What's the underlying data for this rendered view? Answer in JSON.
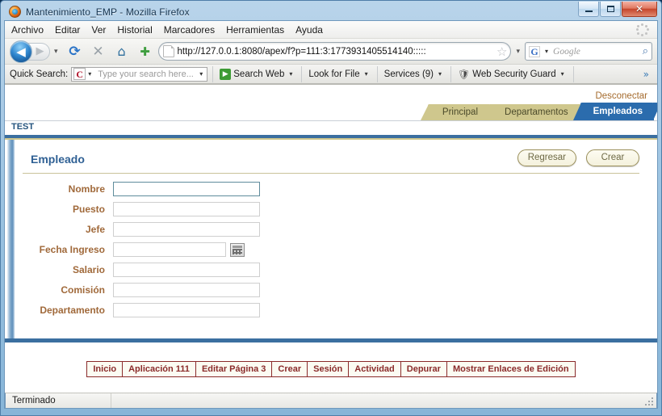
{
  "window": {
    "title": "Mantenimiento_EMP - Mozilla Firefox",
    "logo_icon": "firefox-icon",
    "controls": {
      "minimize": "minimize-icon",
      "maximize": "maximize-icon",
      "close": "✕"
    }
  },
  "menubar": {
    "items": [
      {
        "label": "Archivo"
      },
      {
        "label": "Editar"
      },
      {
        "label": "Ver"
      },
      {
        "label": "Historial"
      },
      {
        "label": "Marcadores"
      },
      {
        "label": "Herramientas"
      },
      {
        "label": "Ayuda"
      }
    ],
    "throbber_icon": "loading-spinner-icon"
  },
  "navbar": {
    "back_icon": "◀",
    "forward_icon": "▶",
    "history_dropdown_icon": "▾",
    "reload_icon": "⟳",
    "stop_icon": "✕",
    "home_icon": "⌂",
    "newpage_icon": "✚",
    "url": "http://127.0.0.1:8080/apex/f?p=111:3:1773931405514140:::::",
    "url_favicon": "page-icon",
    "bookmark_star_icon": "☆",
    "url_dropdown_icon": "▾",
    "search_engine_icon": "G",
    "search_engine_dropdown_icon": "▾",
    "search_placeholder": "Google",
    "search_magnifier_icon": "⌕"
  },
  "addonbar": {
    "quick_search_label": "Quick Search:",
    "quick_search_icon": "C",
    "quick_search_placeholder": "Type your search here...",
    "quick_search_dropdown_icon": "▾",
    "search_web_label": "Search Web",
    "search_web_icon": "▶",
    "search_web_dropdown_icon": "▾",
    "look_for_file_label": "Look for File",
    "look_for_file_dropdown_icon": "▾",
    "services_label": "Services (9)",
    "services_dropdown_icon": "▾",
    "web_security_label": "Web Security Guard",
    "web_security_icon": "shield-icon",
    "web_security_dropdown_icon": "▾",
    "overflow_icon": "»"
  },
  "page": {
    "logout_label": "Desconectar",
    "app_name": "TEST",
    "tabs": [
      {
        "label": "Principal",
        "active": false
      },
      {
        "label": "Departamentos",
        "active": false
      },
      {
        "label": "Empleados",
        "active": true
      }
    ],
    "region": {
      "title": "Empleado",
      "buttons": [
        {
          "label": "Regresar"
        },
        {
          "label": "Crear"
        }
      ],
      "fields": [
        {
          "label": "Nombre",
          "value": "",
          "type": "text",
          "focused": true
        },
        {
          "label": "Puesto",
          "value": "",
          "type": "text",
          "focused": false
        },
        {
          "label": "Jefe",
          "value": "",
          "type": "text",
          "focused": false
        },
        {
          "label": "Fecha Ingreso",
          "value": "",
          "type": "date",
          "focused": false,
          "picker_icon": "calendar-icon"
        },
        {
          "label": "Salario",
          "value": "",
          "type": "text",
          "focused": false
        },
        {
          "label": "Comisión",
          "value": "",
          "type": "text",
          "focused": false
        },
        {
          "label": "Departamento",
          "value": "",
          "type": "text",
          "focused": false
        }
      ]
    },
    "developer_toolbar": [
      {
        "label": "Inicio"
      },
      {
        "label": "Aplicación 111"
      },
      {
        "label": "Editar Página 3"
      },
      {
        "label": "Crear"
      },
      {
        "label": "Sesión"
      },
      {
        "label": "Actividad"
      },
      {
        "label": "Depurar"
      },
      {
        "label": "Mostrar Enlaces de Edición"
      }
    ]
  },
  "statusbar": {
    "text": "Terminado",
    "resize_grip_icon": "resize-grip-icon"
  },
  "colors": {
    "tab_active": "#2b6cad",
    "tab_inactive": "#cfc78d",
    "label": "#a0693a",
    "region_title": "#2f6094",
    "footer_link": "#8a2a2a",
    "rule_blue": "#3b6fa0"
  }
}
